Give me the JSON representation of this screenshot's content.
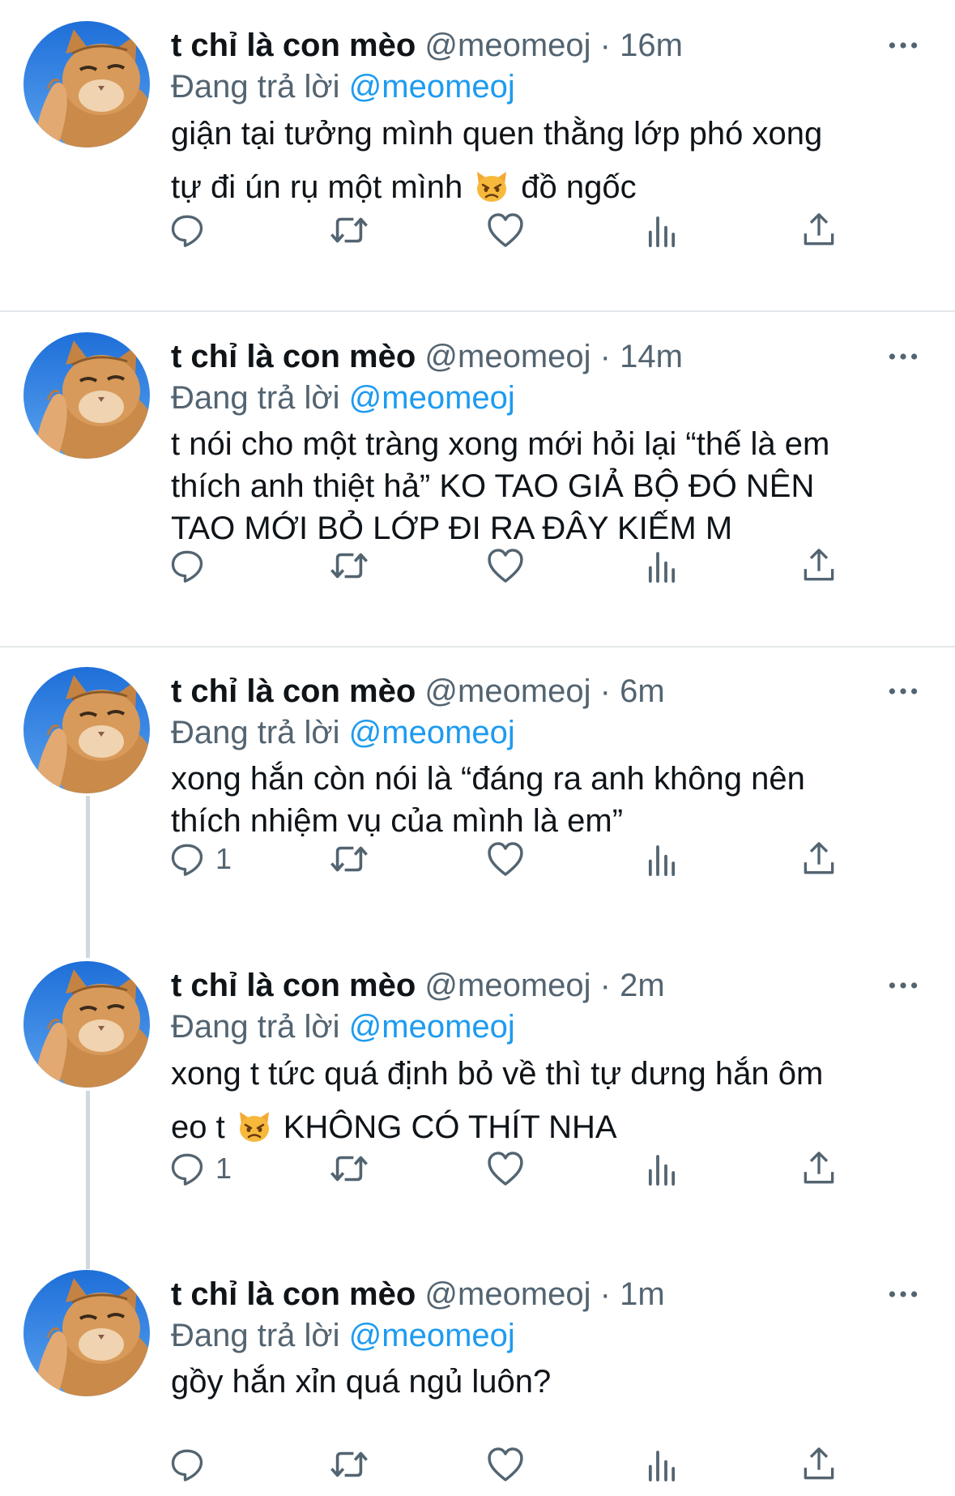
{
  "tweets": [
    {
      "name": "t chỉ là con mèo",
      "handle": "@meomeoj",
      "separator": "·",
      "time": "16m",
      "replying_label": "Đang trả lời",
      "replying_to": "@meomeoj",
      "text_lines": [
        "giận tại tưởng mình quen thằng lớp phó xong",
        "tự đi ún rụ một mình",
        "đồ ngốc"
      ],
      "reply_count": ""
    },
    {
      "name": "t chỉ là con mèo",
      "handle": "@meomeoj",
      "separator": "·",
      "time": "14m",
      "replying_label": "Đang trả lời",
      "replying_to": "@meomeoj",
      "text_lines": [
        "t nói cho một tràng xong mới hỏi lại “thế là em",
        "thích anh thiệt hả” KO TAO GIẢ BỘ ĐÓ NÊN",
        "TAO MỚI BỎ LỚP ĐI RA ĐÂY KIẾM M"
      ],
      "reply_count": ""
    },
    {
      "name": "t chỉ là con mèo",
      "handle": "@meomeoj",
      "separator": "·",
      "time": "6m",
      "replying_label": "Đang trả lời",
      "replying_to": "@meomeoj",
      "text_lines": [
        "xong hắn còn nói là “đáng ra anh không nên",
        "thích nhiệm vụ của mình là em”"
      ],
      "reply_count": "1"
    },
    {
      "name": "t chỉ là con mèo",
      "handle": "@meomeoj",
      "separator": "·",
      "time": "2m",
      "replying_label": "Đang trả lời",
      "replying_to": "@meomeoj",
      "text_lines": [
        "xong t tức quá định bỏ về thì tự dưng hắn ôm",
        "eo t",
        "KHÔNG CÓ THÍT NHA"
      ],
      "reply_count": "1"
    },
    {
      "name": "t chỉ là con mèo",
      "handle": "@meomeoj",
      "separator": "·",
      "time": "1m",
      "replying_label": "Đang trả lời",
      "replying_to": "@meomeoj",
      "text_lines": [
        "gồy hắn xỉn quá ngủ luôn?"
      ],
      "reply_count": ""
    }
  ],
  "colors": {
    "text": "#0f1419",
    "secondary": "#536471",
    "link": "#1d9bf0",
    "thread_line": "#cfd9de",
    "divider": "#e3e7ea"
  },
  "icons": [
    "more-icon",
    "reply-icon",
    "retweet-icon",
    "like-icon",
    "analytics-icon",
    "share-icon",
    "pouting-cat-emoji"
  ]
}
